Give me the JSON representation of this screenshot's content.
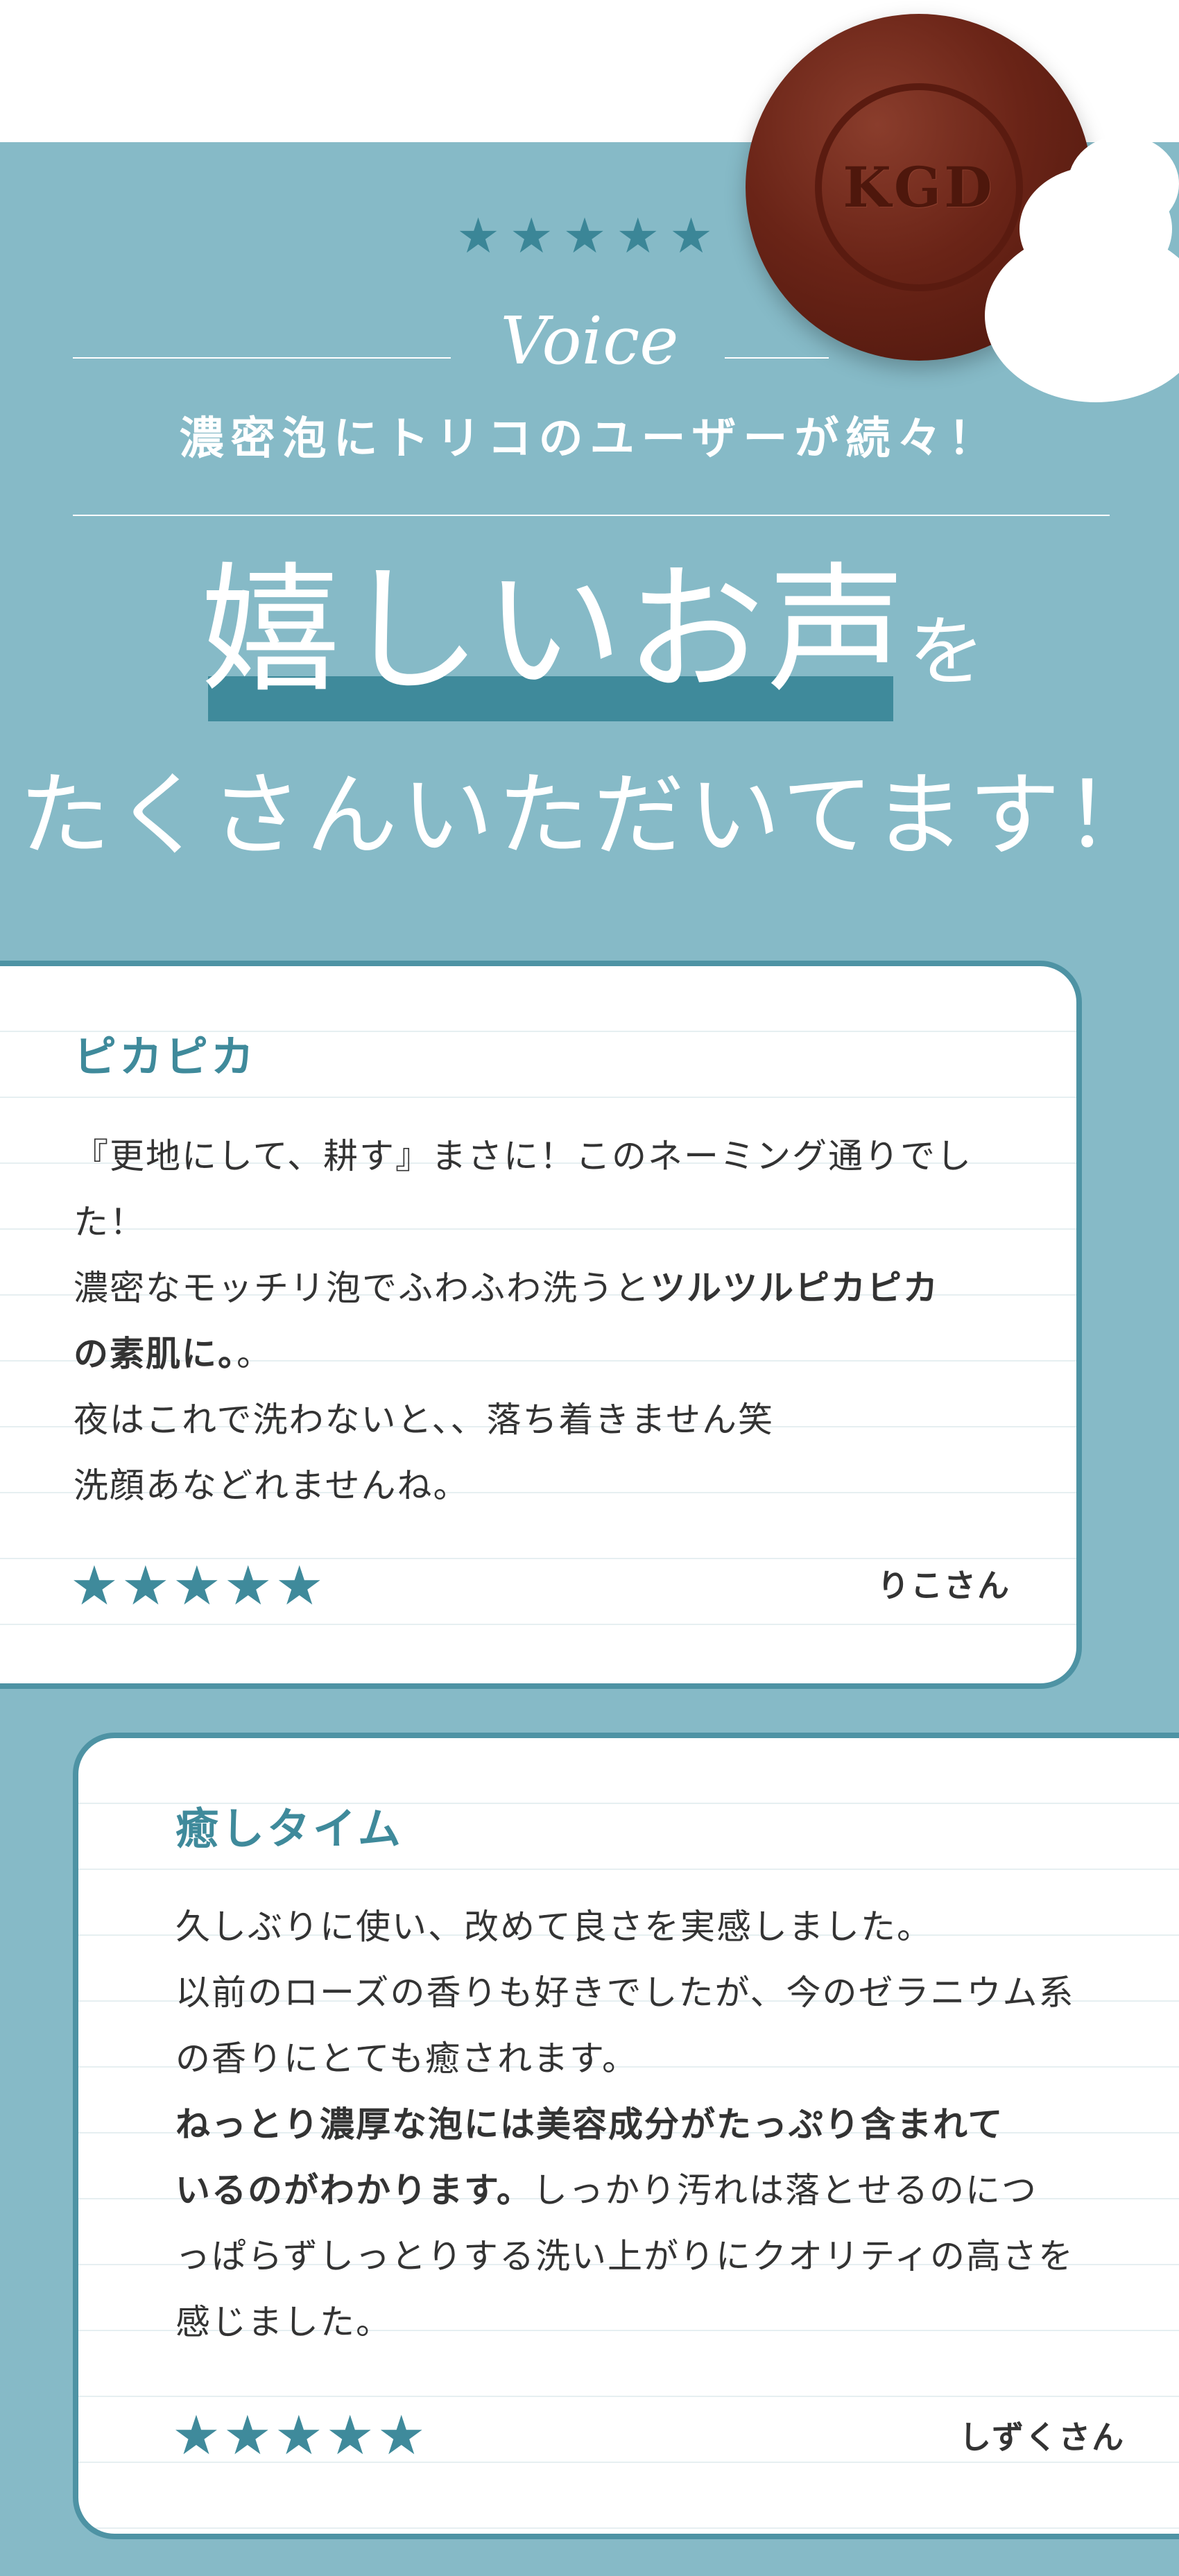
{
  "header": {
    "rating_stars": "★★★★★",
    "section_label": "Voice",
    "subtitle": "濃密泡にトリコのユーザーが続々！",
    "headline_main": "嬉しいお声",
    "headline_particle": "を",
    "headline_line2": "たくさんいただいてます！"
  },
  "product": {
    "logo_text": "KGD"
  },
  "reviews": [
    {
      "title": "ピカピカ",
      "lines": [
        {
          "text": "『更地にして、耕す』まさに！このネーミング通りでし"
        },
        {
          "text": "た！"
        },
        {
          "text": "濃密なモッチリ泡でふわふわ洗うと",
          "bold": "ツルツルピカピカ"
        },
        {
          "bold": "の素肌に。",
          "text": "。"
        },
        {
          "text": "夜はこれで洗わないと、、落ち着きません笑"
        },
        {
          "text": "洗顔あなどれませんね。"
        }
      ],
      "stars": "★★★★★",
      "rating": 5,
      "author": "りこさん"
    },
    {
      "title": "癒しタイム",
      "lines": [
        {
          "text": "久しぶりに使い、改めて良さを実感しました。"
        },
        {
          "text": "以前のローズの香りも好きでしたが、今のゼラニウム系"
        },
        {
          "text": "の香りにとても癒されます。"
        },
        {
          "bold": "ねっとり濃厚な泡には美容成分がたっぷり含まれて"
        },
        {
          "bold": "いるのがわかります。",
          "text": "しっかり汚れは落とせるのにつ"
        },
        {
          "text": "っぱらずしっとりする洗い上がりにクオリティの高さを"
        },
        {
          "text": "感じました。"
        }
      ],
      "stars": "★★★★★",
      "rating": 5,
      "author": "しずくさん"
    }
  ],
  "colors": {
    "background": "#86bac7",
    "accent": "#3f8a9b",
    "soap": "#6a2417"
  }
}
